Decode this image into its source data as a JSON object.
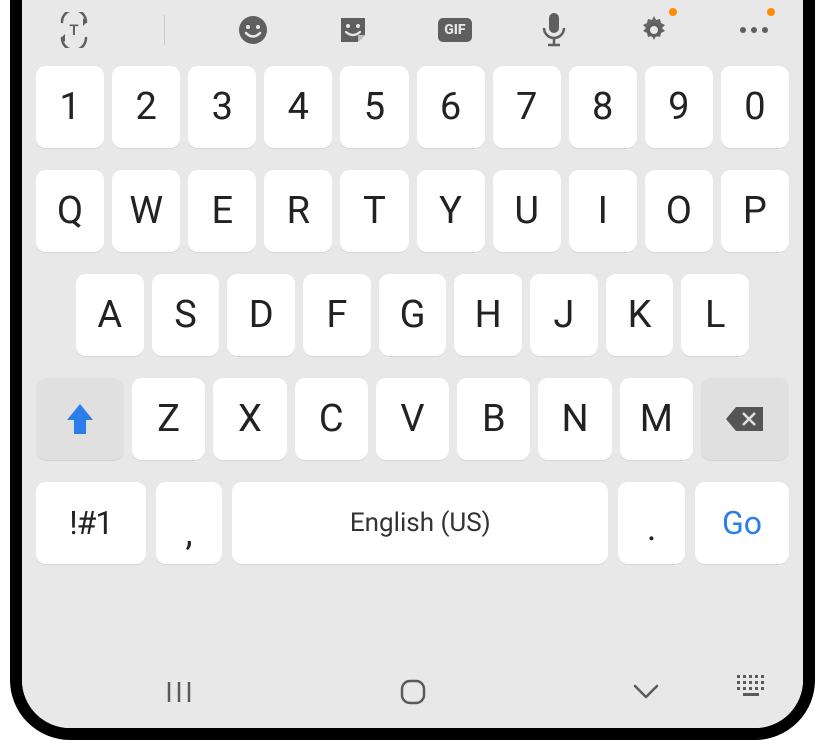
{
  "toolbar": {
    "text_mode": "text-mode-icon",
    "emoji": "emoji-icon",
    "sticker": "sticker-icon",
    "gif": "GIF",
    "mic": "mic-icon",
    "settings": "settings-icon",
    "more": "more-icon"
  },
  "rows": {
    "num": [
      "1",
      "2",
      "3",
      "4",
      "5",
      "6",
      "7",
      "8",
      "9",
      "0"
    ],
    "r1": [
      "Q",
      "W",
      "E",
      "R",
      "T",
      "Y",
      "U",
      "I",
      "O",
      "P"
    ],
    "r2": [
      "A",
      "S",
      "D",
      "F",
      "G",
      "H",
      "J",
      "K",
      "L"
    ],
    "r3": [
      "Z",
      "X",
      "C",
      "V",
      "B",
      "N",
      "M"
    ]
  },
  "bottom": {
    "symbols": "!#1",
    "comma": ",",
    "space": "English (US)",
    "period": ".",
    "go": "Go"
  },
  "nav": {
    "recents": "recents",
    "home": "home",
    "back": "back",
    "keyboard_collapse": "keyboard-collapse"
  }
}
